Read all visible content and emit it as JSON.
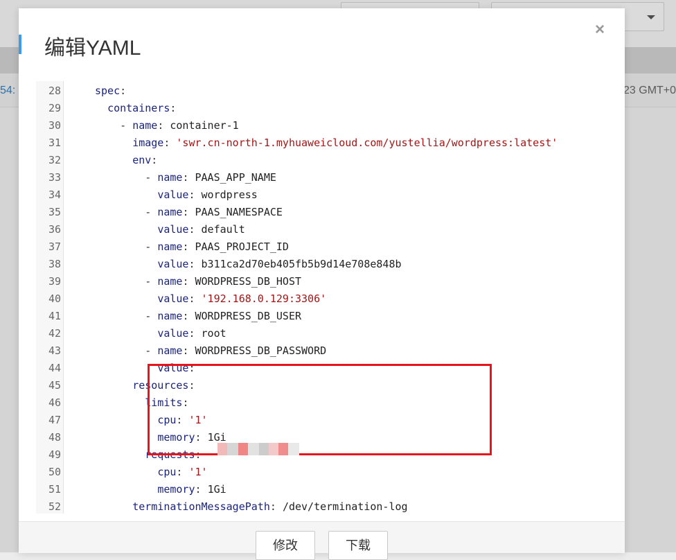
{
  "background": {
    "left_text": "54:",
    "right_text": "23 GMT+0"
  },
  "modal": {
    "title": "编辑YAML",
    "close_label": "×"
  },
  "editor": {
    "lines": [
      {
        "n": "28",
        "indent": "",
        "key": "spec",
        "sep": ":",
        "value": "",
        "vclass": "v"
      },
      {
        "n": "29",
        "indent": "  ",
        "key": "containers",
        "sep": ":",
        "value": "",
        "vclass": "v"
      },
      {
        "n": "30",
        "indent": "    - ",
        "key": "name",
        "sep": ": ",
        "value": "container-1",
        "vclass": "v"
      },
      {
        "n": "31",
        "indent": "      ",
        "key": "image",
        "sep": ": ",
        "value": "'swr.cn-north-1.myhuaweicloud.com/yustellia/wordpress:latest'",
        "vclass": "s"
      },
      {
        "n": "32",
        "indent": "      ",
        "key": "env",
        "sep": ":",
        "value": "",
        "vclass": "v"
      },
      {
        "n": "33",
        "indent": "        - ",
        "key": "name",
        "sep": ": ",
        "value": "PAAS_APP_NAME",
        "vclass": "v"
      },
      {
        "n": "34",
        "indent": "          ",
        "key": "value",
        "sep": ": ",
        "value": "wordpress",
        "vclass": "v"
      },
      {
        "n": "35",
        "indent": "        - ",
        "key": "name",
        "sep": ": ",
        "value": "PAAS_NAMESPACE",
        "vclass": "v"
      },
      {
        "n": "36",
        "indent": "          ",
        "key": "value",
        "sep": ": ",
        "value": "default",
        "vclass": "v"
      },
      {
        "n": "37",
        "indent": "        - ",
        "key": "name",
        "sep": ": ",
        "value": "PAAS_PROJECT_ID",
        "vclass": "v"
      },
      {
        "n": "38",
        "indent": "          ",
        "key": "value",
        "sep": ": ",
        "value": "b311ca2d70eb405fb5b9d14e708e848b",
        "vclass": "v"
      },
      {
        "n": "39",
        "indent": "        - ",
        "key": "name",
        "sep": ": ",
        "value": "WORDPRESS_DB_HOST",
        "vclass": "v"
      },
      {
        "n": "40",
        "indent": "          ",
        "key": "value",
        "sep": ": ",
        "value": "'192.168.0.129:3306'",
        "vclass": "s"
      },
      {
        "n": "41",
        "indent": "        - ",
        "key": "name",
        "sep": ": ",
        "value": "WORDPRESS_DB_USER",
        "vclass": "v"
      },
      {
        "n": "42",
        "indent": "          ",
        "key": "value",
        "sep": ": ",
        "value": "root",
        "vclass": "v"
      },
      {
        "n": "43",
        "indent": "        - ",
        "key": "name",
        "sep": ": ",
        "value": "WORDPRESS_DB_PASSWORD",
        "vclass": "v"
      },
      {
        "n": "44",
        "indent": "          ",
        "key": "value",
        "sep": ":",
        "value": "",
        "vclass": "v"
      },
      {
        "n": "45",
        "indent": "      ",
        "key": "resources",
        "sep": ":",
        "value": "",
        "vclass": "v"
      },
      {
        "n": "46",
        "indent": "        ",
        "key": "limits",
        "sep": ":",
        "value": "",
        "vclass": "v"
      },
      {
        "n": "47",
        "indent": "          ",
        "key": "cpu",
        "sep": ": ",
        "value": "'1'",
        "vclass": "s"
      },
      {
        "n": "48",
        "indent": "          ",
        "key": "memory",
        "sep": ": ",
        "value": "1Gi",
        "vclass": "v"
      },
      {
        "n": "49",
        "indent": "        ",
        "key": "requests",
        "sep": ":",
        "value": "",
        "vclass": "v"
      },
      {
        "n": "50",
        "indent": "          ",
        "key": "cpu",
        "sep": ": ",
        "value": "'1'",
        "vclass": "s"
      },
      {
        "n": "51",
        "indent": "          ",
        "key": "memory",
        "sep": ": ",
        "value": "1Gi",
        "vclass": "v"
      },
      {
        "n": "52",
        "indent": "      ",
        "key": "terminationMessagePath",
        "sep": ": ",
        "value": "/dev/termination-log",
        "vclass": "v"
      }
    ]
  },
  "footer": {
    "modify_label": "修改",
    "download_label": "下载"
  },
  "colors": {
    "accent": "#3f9be8",
    "highlight": "#e8141c",
    "yaml_key": "#1a237e",
    "yaml_string": "#a31515"
  }
}
